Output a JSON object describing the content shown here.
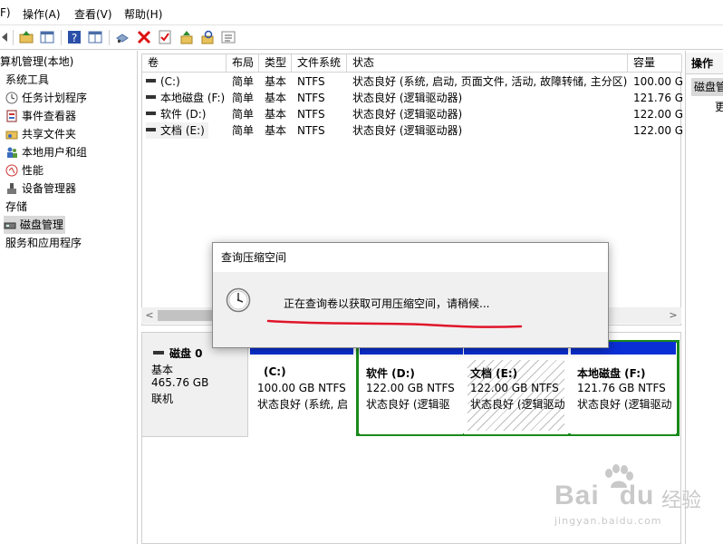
{
  "menu": {
    "file": "F)",
    "action": "操作(A)",
    "view": "查看(V)",
    "help": "帮助(H)"
  },
  "toolbar": {
    "icons": [
      "back-arrow-icon",
      "up-folder-icon",
      "show-hide-tree-icon",
      "help-icon",
      "properties-icon",
      "connect-icon",
      "delete-icon",
      "check-icon",
      "export-up-icon",
      "search-key-icon",
      "list-icon"
    ]
  },
  "tree": {
    "root": "算机管理(本地)",
    "system_tools": "系统工具",
    "task_scheduler": "任务计划程序",
    "event_viewer": "事件查看器",
    "shared_folders": "共享文件夹",
    "local_users": "本地用户和组",
    "performance": "性能",
    "device_manager": "设备管理器",
    "storage": "存储",
    "disk_management": "磁盘管理",
    "services_apps": "服务和应用程序"
  },
  "volume_list": {
    "headers": [
      "卷",
      "布局",
      "类型",
      "文件系统",
      "状态",
      "容量"
    ],
    "rows": [
      {
        "volume": "(C:)",
        "layout": "简单",
        "type": "基本",
        "fs": "NTFS",
        "status": "状态良好 (系统, 启动, 页面文件, 活动, 故障转储, 主分区)",
        "capacity": "100.00 G"
      },
      {
        "volume": "本地磁盘 (F:)",
        "layout": "简单",
        "type": "基本",
        "fs": "NTFS",
        "status": "状态良好 (逻辑驱动器)",
        "capacity": "121.76 G"
      },
      {
        "volume": "软件 (D:)",
        "layout": "简单",
        "type": "基本",
        "fs": "NTFS",
        "status": "状态良好 (逻辑驱动器)",
        "capacity": "122.00 G"
      },
      {
        "volume": "文档 (E:)",
        "layout": "简单",
        "type": "基本",
        "fs": "NTFS",
        "status": "状态良好 (逻辑驱动器)",
        "capacity": "122.00 G"
      }
    ]
  },
  "scrollbar": {
    "left_arrow": "<",
    "right_arrow": ">"
  },
  "disk": {
    "name": "磁盘 0",
    "kind": "基本",
    "size": "465.76 GB",
    "state": "联机",
    "partitions": [
      {
        "name": "(C:)",
        "size": "100.00 GB NTFS",
        "status": "状态良好 (系统, 启",
        "top_color": "#0a2fd4"
      },
      {
        "name": "软件  (D:)",
        "size": "122.00 GB NTFS",
        "status": "状态良好 (逻辑驱",
        "top_color": "#0a2fd4"
      },
      {
        "name": "文档  (E:)",
        "size": "122.00 GB NTFS",
        "status": "状态良好 (逻辑驱动",
        "top_color": "#0a2fd4"
      },
      {
        "name": "本地磁盘  (F:)",
        "size": "121.76 GB NTFS",
        "status": "状态良好 (逻辑驱动",
        "top_color": "#0a2fd4"
      }
    ],
    "extended_border_color": "#1a8a1a"
  },
  "actions": {
    "header": "操作",
    "selected": "磁盘管",
    "more": "更"
  },
  "dialog": {
    "title": "查询压缩空间",
    "message": "正在查询卷以获取可用压缩空间，请稍候...",
    "icon": "clock-icon",
    "annotation_color": "#e0152a"
  },
  "watermark": {
    "brand": "Bai",
    "brand2": "du",
    "sub": "经验",
    "url": "jingyan.baidu.com",
    "color": "#c9c9c9"
  }
}
